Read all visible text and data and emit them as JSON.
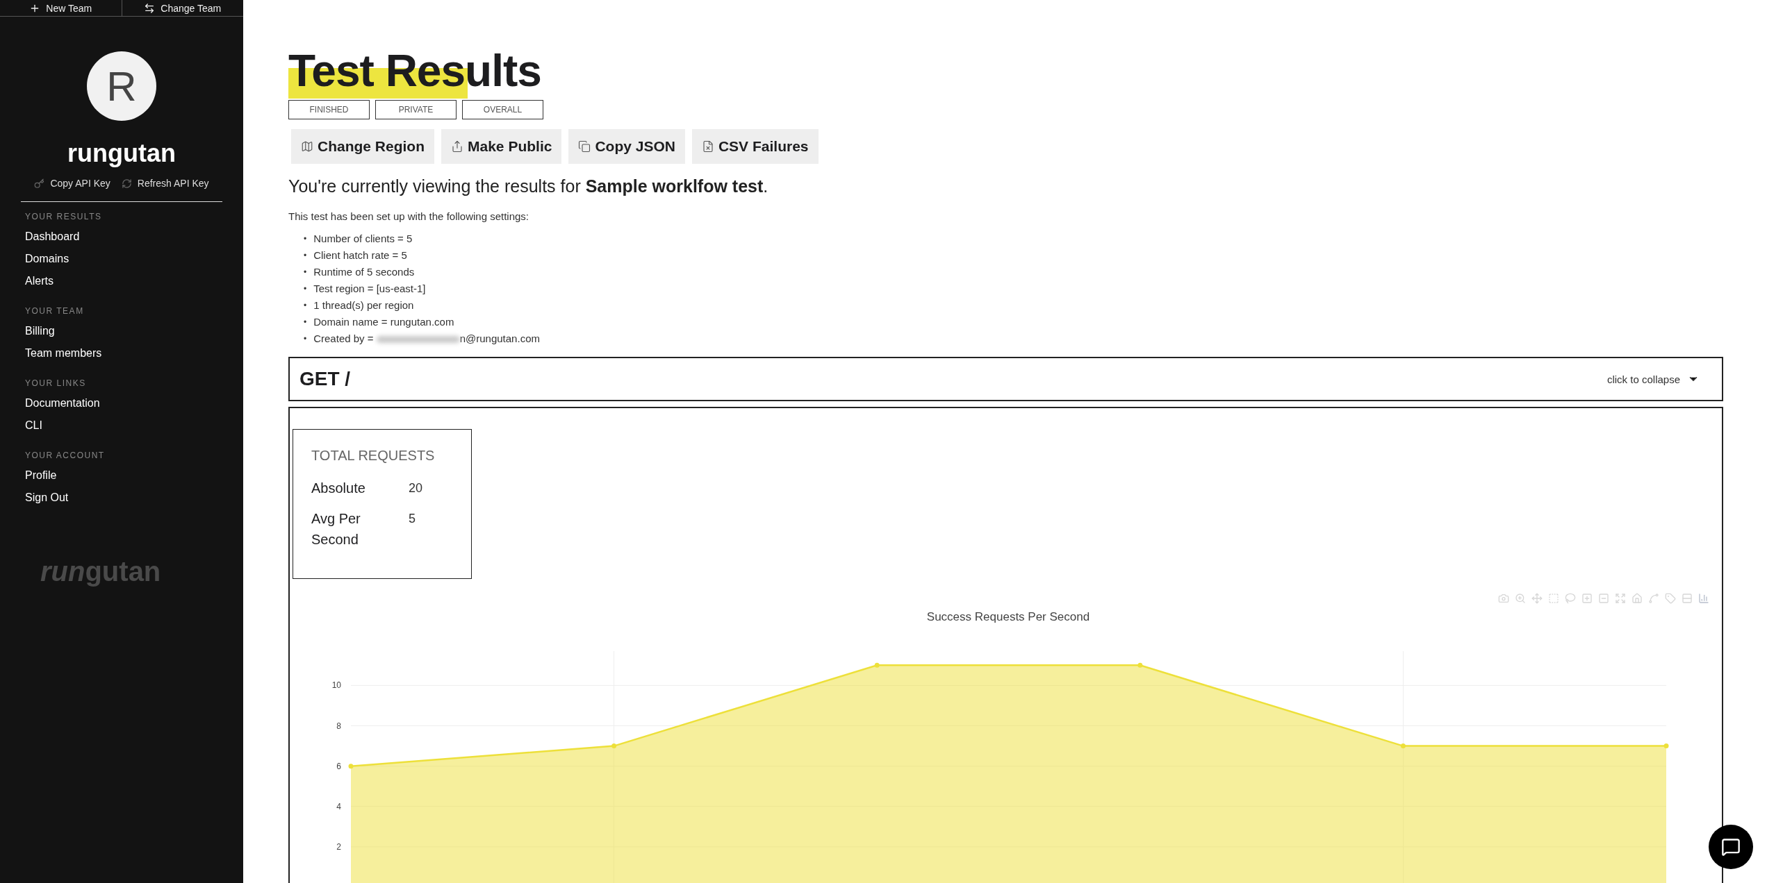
{
  "sidebar": {
    "top_actions": [
      {
        "kind": "plus",
        "label": "New Team"
      },
      {
        "kind": "swap",
        "label": "Change Team"
      }
    ],
    "avatar": {
      "initial": "R"
    },
    "team_name": "rungutan",
    "key_actions": [
      {
        "kind": "key",
        "label": "Copy API Key"
      },
      {
        "kind": "refresh",
        "label": "Refresh API Key"
      }
    ],
    "sections": [
      {
        "title": "YOUR RESULTS",
        "items": [
          "Dashboard",
          "Domains",
          "Alerts"
        ]
      },
      {
        "title": "YOUR TEAM",
        "items": [
          "Billing",
          "Team members"
        ]
      },
      {
        "title": "YOUR LINKS",
        "items": [
          "Documentation",
          "CLI"
        ]
      },
      {
        "title": "YOUR ACCOUNT",
        "items": [
          "Profile",
          "Sign Out"
        ]
      }
    ],
    "logo": {
      "part_1": "run",
      "part_2": "gutan"
    }
  },
  "page": {
    "title": "Test Results",
    "tags": [
      "FINISHED",
      "PRIVATE",
      "OVERALL"
    ],
    "actions": [
      {
        "kind": "map",
        "label": "Change Region"
      },
      {
        "kind": "share",
        "label": "Make Public"
      },
      {
        "kind": "copy",
        "label": "Copy JSON"
      },
      {
        "kind": "csv",
        "label": "CSV Failures"
      }
    ],
    "intro": "You're currently viewing the results for **Sample worklfow test**.",
    "settings_heading": "This test has been set up with the following settings:",
    "settings": [
      {
        "marker": "•",
        "text": "Number of clients = 5",
        "redacted": false
      },
      {
        "marker": "•",
        "text": "Client hatch rate = 5",
        "redacted": false
      },
      {
        "marker": "•",
        "text": "Runtime of 5 seconds",
        "redacted": false
      },
      {
        "marker": "•",
        "text": "Test region = [us-east-1]",
        "redacted": false
      },
      {
        "marker": "•",
        "text": "1 thread(s) per region",
        "redacted": false
      },
      {
        "marker": "•",
        "text": "Domain name = rungutan.com",
        "redacted": false
      },
      {
        "marker": "•",
        "text": "Created by = ",
        "redacted": true,
        "after": "n@rungutan.com"
      }
    ]
  },
  "endpoint": {
    "title": "GET /",
    "toggle": "click to collapse",
    "expanded": true,
    "stats": {
      "title": "TOTAL REQUESTS",
      "rows": [
        {
          "label": "Absolute",
          "value": "20"
        },
        {
          "label": "Avg Per Second",
          "value": "5"
        }
      ]
    },
    "chart_data": {
      "type": "area",
      "title": "Success Requests Per Second",
      "series": [
        {
          "color": "#ede03a",
          "values": [
            6,
            7,
            11,
            11,
            7,
            7
          ]
        }
      ],
      "ylim": [
        0,
        11.7
      ],
      "grid": true,
      "yticks": [
        2,
        4,
        6,
        8,
        10
      ]
    }
  }
}
